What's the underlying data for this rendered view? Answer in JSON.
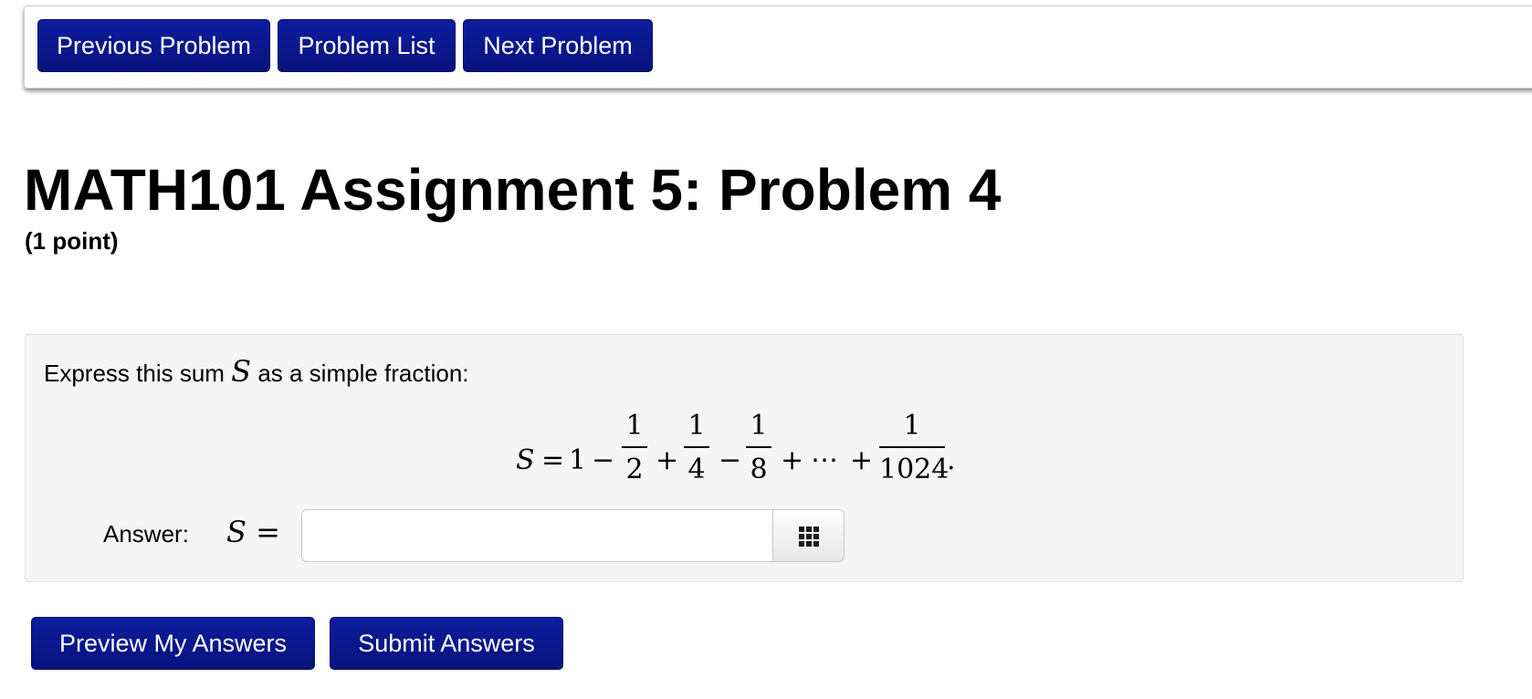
{
  "nav": {
    "previous_label": "Previous Problem",
    "list_label": "Problem List",
    "next_label": "Next Problem"
  },
  "page": {
    "title": "MATH101 Assignment 5: Problem 4",
    "points": "(1 point)"
  },
  "problem": {
    "statement_before": "Express this sum ",
    "statement_var": "S",
    "statement_after": " as a simple fraction:",
    "equation": {
      "lhs": "S",
      "equals": "=",
      "first_term": "1",
      "op1": "−",
      "frac1_num": "1",
      "frac1_den": "2",
      "op2": "+",
      "frac2_num": "1",
      "frac2_den": "4",
      "op3": "−",
      "frac3_num": "1",
      "frac3_den": "8",
      "op4": "+",
      "ellipsis": "⋯",
      "op5": "+",
      "frac4_num": "1",
      "frac4_den": "1024",
      "period": "."
    },
    "answer_label": "Answer:",
    "answer_var": "S =",
    "answer_value": "",
    "editor_icon": "grid-icon"
  },
  "actions": {
    "preview_label": "Preview My Answers",
    "submit_label": "Submit Answers"
  },
  "colors": {
    "button_blue": "#0b1894",
    "problem_bg": "#f5f5f5"
  }
}
